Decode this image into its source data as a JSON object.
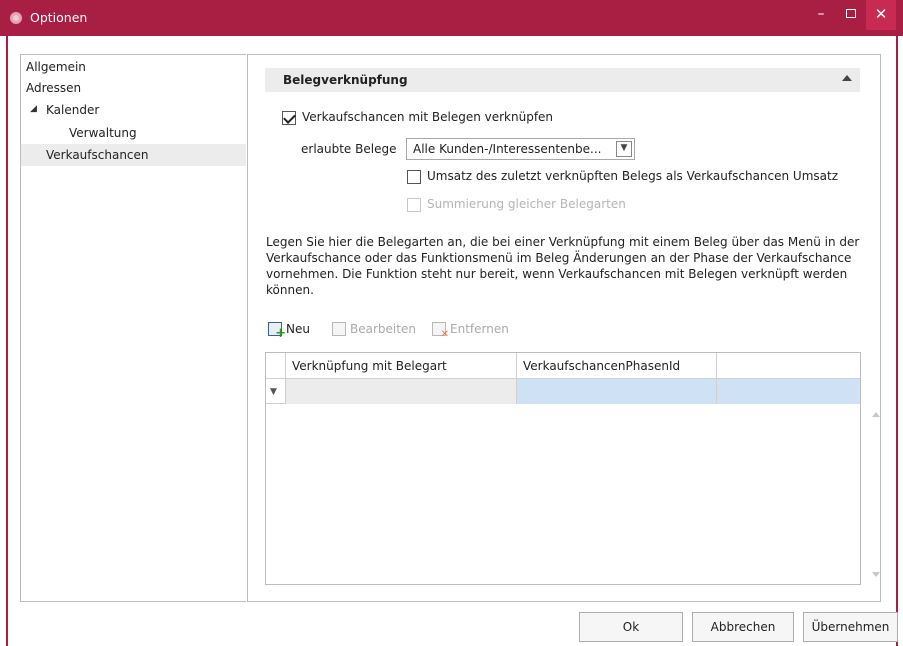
{
  "window": {
    "title": "Optionen",
    "accent": "#a81f43"
  },
  "nav": {
    "items": [
      {
        "label": "Allgemein"
      },
      {
        "label": "Adressen"
      },
      {
        "label": "Kalender"
      },
      {
        "label": "Verwaltung"
      },
      {
        "label": "Verkaufschancen",
        "selected": true
      }
    ]
  },
  "section": {
    "title": "Belegverknüpfung",
    "link_checkbox": {
      "label": "Verkaufschancen mit Belegen verknüpfen",
      "checked": true
    },
    "allowed": {
      "label": "erlaubte Belege",
      "value": "Alle Kunden-/Interessentenbe..."
    },
    "turnover_checkbox": {
      "label": "Umsatz des zuletzt verknüpften Belegs als Verkaufschancen Umsatz",
      "checked": false
    },
    "sum_checkbox": {
      "label": "Summierung gleicher Belegarten",
      "checked": false,
      "disabled": true
    },
    "description": "Legen Sie hier die Belegarten an, die bei einer Verknüpfung mit einem Beleg über das Menü in der Verkaufschance oder das Funktionsmenü im Beleg Änderungen an der Phase der Verkaufschance vornehmen. Die Funktion steht nur bereit, wenn Verkaufschancen mit Belegen verknüpft werden können."
  },
  "toolbar": {
    "new": "Neu",
    "edit": "Bearbeiten",
    "remove": "Entfernen"
  },
  "grid": {
    "columns": [
      "Verknüpfung mit Belegart",
      "VerkaufschancenPhasenId",
      ""
    ],
    "filter_highlight": "#cfe2f5",
    "rows": []
  },
  "footer": {
    "ok": "Ok",
    "cancel": "Abbrechen",
    "apply": "Übernehmen"
  }
}
